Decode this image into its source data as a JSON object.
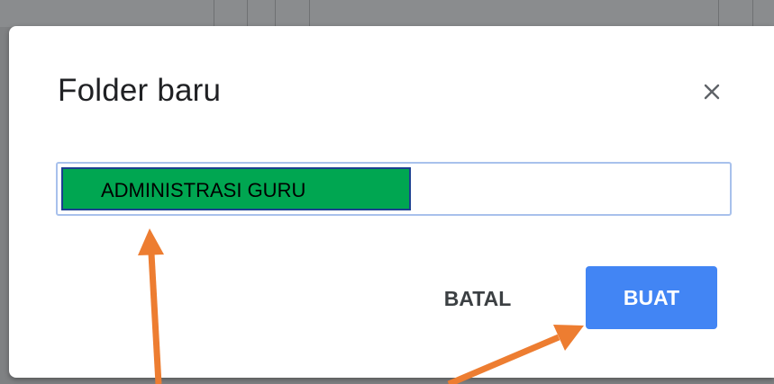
{
  "dialog": {
    "title": "Folder baru",
    "close_icon": "close-icon",
    "name_input": {
      "value": "ADMINISTRASI GURU"
    },
    "buttons": {
      "cancel_label": "BATAL",
      "create_label": "BUAT"
    }
  },
  "colors": {
    "primary_button": "#4285f4",
    "input_focus_border": "#a8c1ec",
    "highlight_fill": "#00a651",
    "highlight_border": "#1c3f91",
    "annotation_arrow": "#ed7d31",
    "scrim": "#7f8183"
  },
  "annotations": {
    "arrow_icon": "arrow-up-icon"
  }
}
